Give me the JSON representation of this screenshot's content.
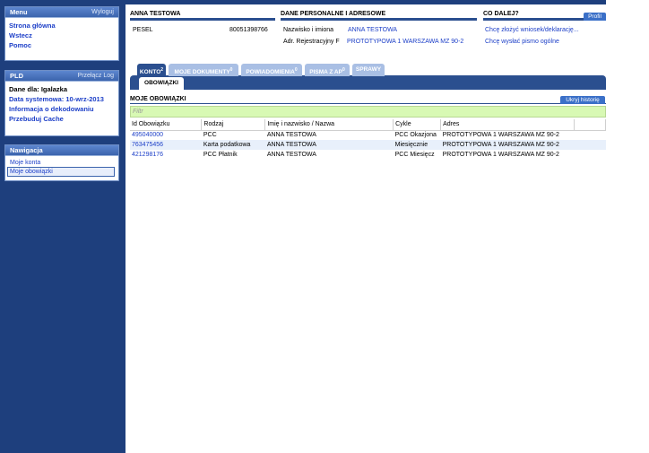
{
  "sidebar": {
    "menu": {
      "title": "Menu",
      "action": "Wyloguj",
      "items": [
        "Strona główna",
        "Wstecz",
        "Pomoc"
      ]
    },
    "pld": {
      "title": "PLD",
      "action": "Przełącz Log",
      "user_line": "Dane dla: Igalazka",
      "system_date": "Data systemowa: 10-wrz-2013",
      "links": [
        "Informacja o dekodowaniu",
        "Przebuduj Cache"
      ]
    },
    "nav": {
      "title": "Nawigacja",
      "items": [
        "Moje konta",
        "Moje obowiązki"
      ]
    }
  },
  "header": {
    "person": {
      "title": "ANNA TESTOWA",
      "pesel_label": "PESEL",
      "pesel_value": "80051398766"
    },
    "personal": {
      "title": "DANE PERSONALNE I ADRESOWE",
      "name_label": "Nazwisko i imiona",
      "name_value": "ANNA TESTOWA",
      "addr_label": "Adr. Rejestracyjny F",
      "addr_value": "PROTOTYPOWA 1 WARSZAWA MZ 90-2"
    },
    "next": {
      "title": "CO DALEJ?",
      "profil_label": "Profil",
      "actions": [
        "Chcę złożyć wniosek/deklarację...",
        "Chcę wysłać pismo ogólne"
      ]
    }
  },
  "tabs": [
    {
      "label": "KONTO",
      "sup": "2"
    },
    {
      "label": "MOJE DOKUMENTY",
      "sup": "0"
    },
    {
      "label": "POWIADOMIENIA",
      "sup": "0"
    },
    {
      "label": "PISMA Z AP",
      "sup": "0"
    },
    {
      "label": "SPRAWY",
      "sup": ""
    }
  ],
  "subtab": "OBOWIĄZKI",
  "section": {
    "title": "MOJE OBOWIĄZKI",
    "hide_history": "Ukryj historię",
    "filter_placeholder": "Filtr"
  },
  "table": {
    "columns": [
      "Id Obowiązku",
      "Rodzaj",
      "Imię i nazwisko / Nazwa",
      "Cykle",
      "Adres",
      ""
    ],
    "rows": [
      [
        "495040000",
        "PCC",
        "ANNA TESTOWA",
        "PCC Okazjona",
        "PROTOTYPOWA 1 WARSZAWA MZ 90-2"
      ],
      [
        "763475456",
        "Karta podatkowa",
        "ANNA TESTOWA",
        "Miesięcznie",
        "PROTOTYPOWA 1 WARSZAWA MZ 90-2"
      ],
      [
        "421298176",
        "PCC Płatnik",
        "ANNA TESTOWA",
        "PCC Miesięcz",
        "PROTOTYPOWA 1 WARSZAWA MZ 90-2"
      ]
    ]
  },
  "colors": {
    "sidebar": "#1e3f7d",
    "link": "#1e40c8",
    "filter_bg": "#d8f9b4",
    "row_alt": "#e8f0fb"
  }
}
